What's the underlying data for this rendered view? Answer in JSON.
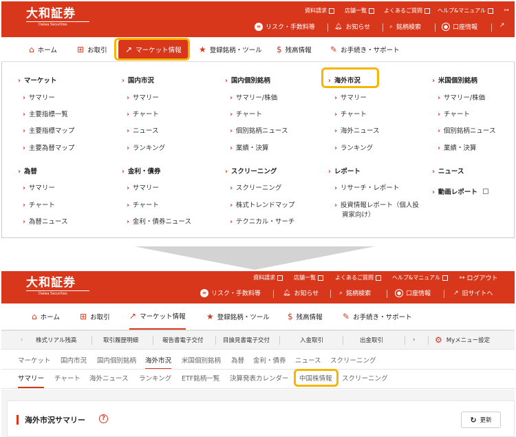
{
  "brand": {
    "logo_jp": "大和証券",
    "logo_en": "Daiwa Securities"
  },
  "util_links": [
    "資料請求",
    "店舗一覧",
    "よくあるご質問",
    "ヘルプ&マニュアル"
  ],
  "logout": "ログアウト",
  "actions": {
    "risk": "リスク・手数料等",
    "notice": "お知らせ",
    "search": "銘柄検索",
    "account": "口座情報",
    "old_site": "旧サイトへ"
  },
  "nav": [
    "ホーム",
    "お取引",
    "マーケット情報",
    "登録銘柄・ツール",
    "残高情報",
    "お手続き・サポート"
  ],
  "mega_menu": {
    "columns": [
      {
        "heading": "マーケット",
        "items": [
          "サマリー",
          "主要指標一覧",
          "主要指標マップ",
          "主要為替マップ"
        ]
      },
      {
        "heading": "国内市況",
        "items": [
          "サマリー",
          "チャート",
          "ニュース",
          "ランキング"
        ]
      },
      {
        "heading": "国内個別銘柄",
        "items": [
          "サマリー/株価",
          "チャート",
          "個別銘柄ニュース",
          "業績・決算"
        ]
      },
      {
        "heading": "海外市況",
        "items": [
          "サマリー",
          "チャート",
          "海外ニュース",
          "ランキング"
        ]
      },
      {
        "heading": "米国個別銘柄",
        "items": [
          "サマリー/株価",
          "チャート",
          "個別銘柄ニュース",
          "業績・決算"
        ]
      }
    ],
    "columns2": [
      {
        "heading": "為替",
        "items": [
          "サマリー",
          "チャート",
          "為替ニュース"
        ]
      },
      {
        "heading": "金利・債券",
        "items": [
          "サマリー",
          "チャート",
          "金利・債券ニュース"
        ]
      },
      {
        "heading": "スクリーニング",
        "items": [
          "スクリーニング",
          "株式トレンドマップ",
          "テクニカル・サーチ"
        ]
      },
      {
        "heading": "レポート",
        "items": [
          "リサーチ・レポート",
          "投資情報レポート（個人投",
          "資家向け）"
        ]
      },
      {
        "heading": "ニュース",
        "items": []
      },
      {
        "heading": "動画レポート",
        "items": []
      }
    ]
  },
  "quick_bar": [
    "株式リアル残高",
    "取引履歴明細",
    "報告書電子交付",
    "目論見書電子交付",
    "入金取引",
    "出金取引"
  ],
  "my_menu": "Myメニュー設定",
  "tabs1": [
    "マーケット",
    "国内市況",
    "国内個別銘柄",
    "海外市況",
    "米国個別銘柄",
    "為替",
    "金利・債券",
    "ニュース",
    "スクリーニング"
  ],
  "tabs2": [
    "サマリー",
    "チャート",
    "海外ニュース",
    "ランキング",
    "ETF銘柄一覧",
    "決算発表カレンダー",
    "中国株情報",
    "スクリーニング"
  ],
  "page_title": "海外市況サマリー",
  "refresh": "更新",
  "colors": {
    "brand": "#d9371b",
    "highlight": "#f7b500"
  }
}
